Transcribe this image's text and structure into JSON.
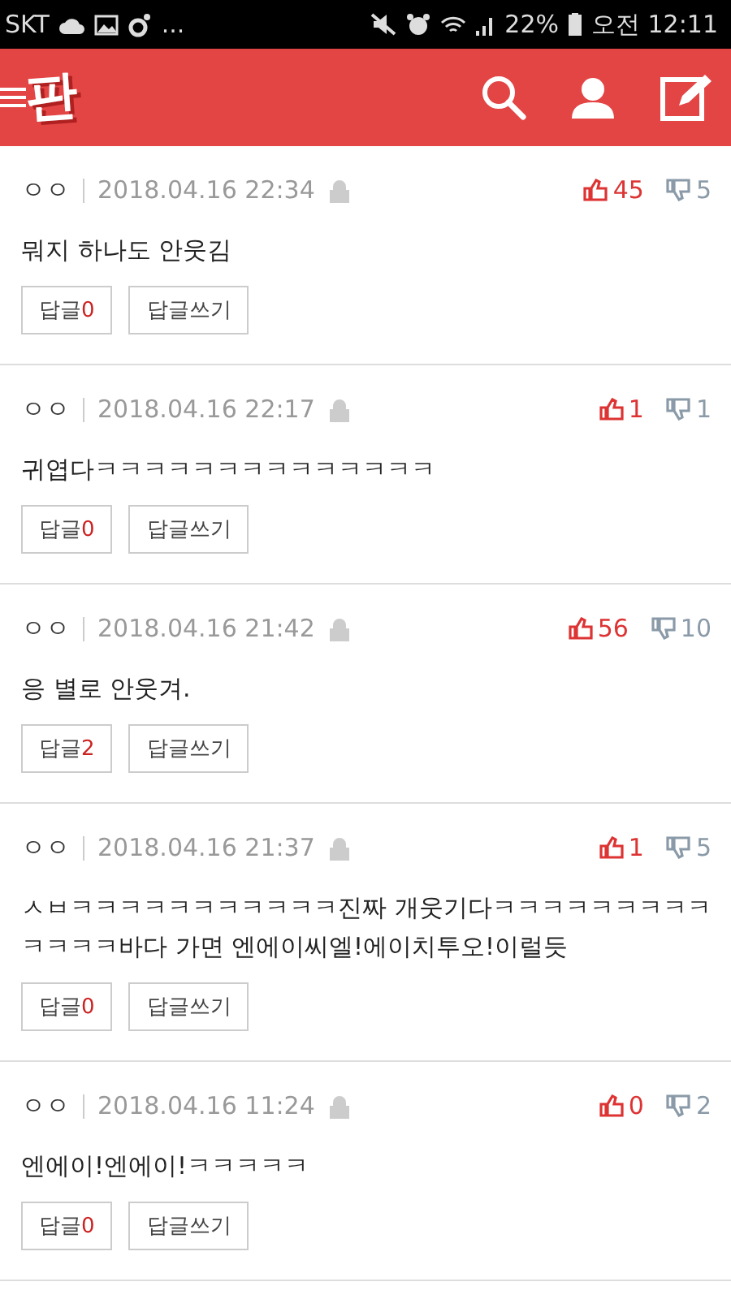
{
  "status_bar": {
    "carrier": "SKT",
    "more": "...",
    "battery": "22%",
    "time": "오전 12:11"
  },
  "header": {
    "logo": "판"
  },
  "comments": [
    {
      "author": "ㅇㅇ",
      "date": "2018.04.16 22:34",
      "likes": "45",
      "dislikes": "5",
      "text": "뭐지 하나도 안웃김",
      "reply_label": "답글",
      "reply_count": "0",
      "write_reply": "답글쓰기"
    },
    {
      "author": "ㅇㅇ",
      "date": "2018.04.16 22:17",
      "likes": "1",
      "dislikes": "1",
      "text": "귀엽다ㅋㅋㅋㅋㅋㅋㅋㅋㅋㅋㅋㅋㅋㅋ",
      "reply_label": "답글",
      "reply_count": "0",
      "write_reply": "답글쓰기"
    },
    {
      "author": "ㅇㅇ",
      "date": "2018.04.16 21:42",
      "likes": "56",
      "dislikes": "10",
      "text": "응 별로 안웃겨.",
      "reply_label": "답글",
      "reply_count": "2",
      "write_reply": "답글쓰기"
    },
    {
      "author": "ㅇㅇ",
      "date": "2018.04.16 21:37",
      "likes": "1",
      "dislikes": "5",
      "text": "ㅅㅂㅋㅋㅋㅋㅋㅋㅋㅋㅋㅋㅋ진짜 개웃기다ㅋㅋㅋㅋㅋㅋㅋㅋㅋㅋㅋㅋㅋ바다 가면 엔에이씨엘!에이치투오!이럴듯",
      "reply_label": "답글",
      "reply_count": "0",
      "write_reply": "답글쓰기"
    },
    {
      "author": "ㅇㅇ",
      "date": "2018.04.16 11:24",
      "likes": "0",
      "dislikes": "2",
      "text": "엔에이!엔에이!ㅋㅋㅋㅋㅋ",
      "reply_label": "답글",
      "reply_count": "0",
      "write_reply": "답글쓰기"
    }
  ]
}
